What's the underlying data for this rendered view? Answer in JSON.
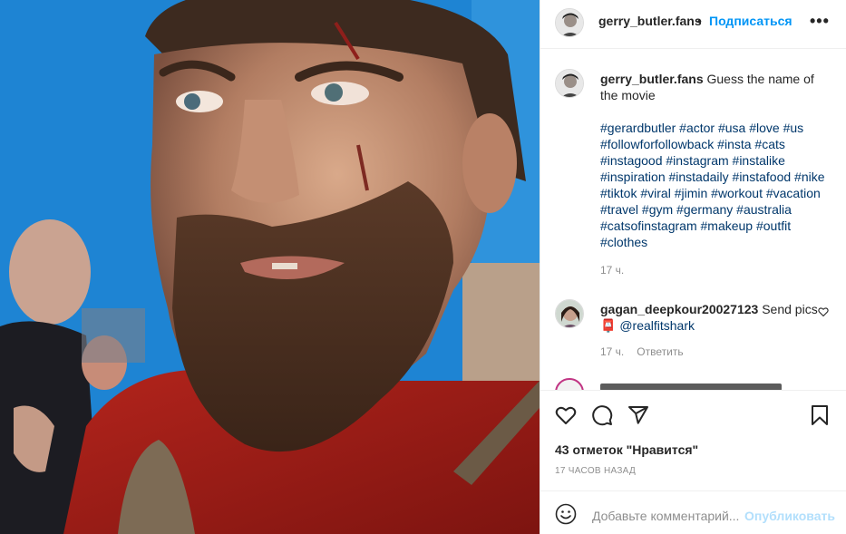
{
  "post_image": {
    "alt": ""
  },
  "header": {
    "username": "gerry_butler.fans",
    "separator": "•",
    "follow_label": "Подписаться",
    "more_icon": "more-horizontal-icon"
  },
  "caption": {
    "username": "gerry_butler.fans",
    "text": " Guess the name of the movie",
    "hashtags": "#gerardbutler #actor #usa #love #us #followforfollowback #insta #cats #instagood #instagram #instalike #inspiration #instadaily #instafood #nike #tiktok #viral #jimin #workout #vacation #travel #gym #germany #australia #catsofinstagram #makeup #outfit #clothes",
    "time": "17 ч."
  },
  "comments": [
    {
      "username": "gagan_deepkour20027123",
      "text": " Send pics",
      "emoji": "📮",
      "mention": "@realfitshark",
      "time": "17 ч.",
      "reply_label": "Ответить"
    },
    {
      "username": "",
      "text": ""
    }
  ],
  "actions": {
    "icons": [
      "heart-icon",
      "comment-icon",
      "share-icon",
      "bookmark-icon"
    ],
    "likes": "43 отметок \"Нравится\"",
    "timestamp": "17 ЧАСОВ НАЗАД"
  },
  "add_comment": {
    "placeholder": "Добавьте комментарий...",
    "publish_label": "Опубликовать"
  },
  "colors": {
    "link_blue": "#0095f6",
    "hashtag": "#00376b",
    "muted": "#8e8e8e",
    "publish_disabled": "#b2dffc"
  }
}
